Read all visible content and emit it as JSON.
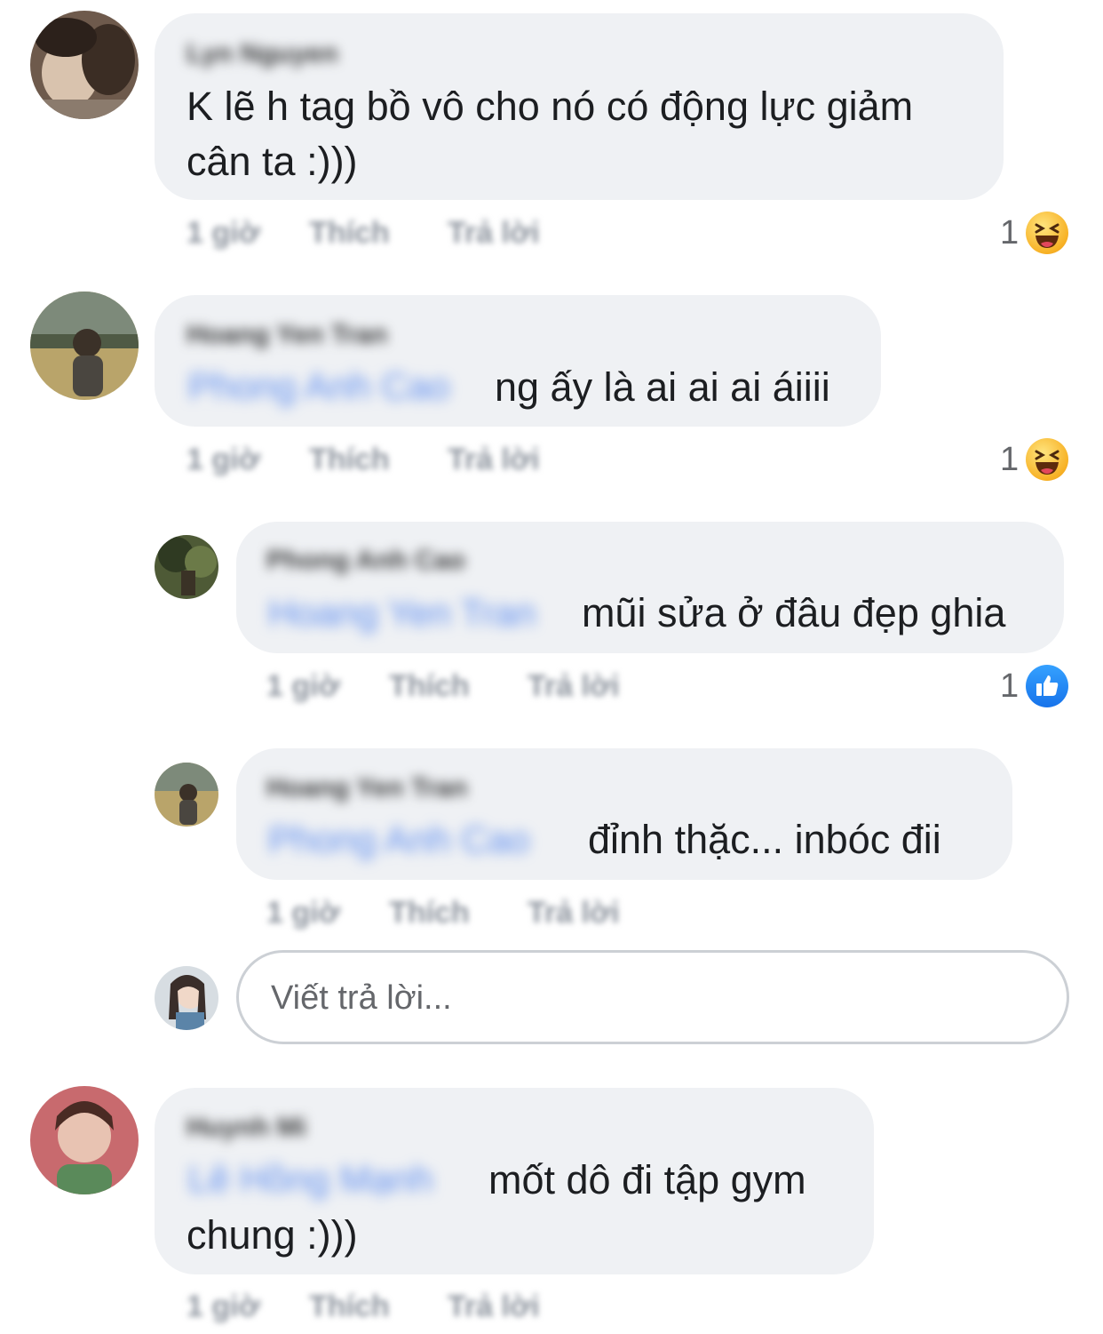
{
  "comments": [
    {
      "author": "Lyn Nguyen",
      "text_lines": [
        "K lẽ h tag bồ vô cho nó có động lực giảm",
        "cân ta :)))"
      ],
      "time": "1 giờ",
      "like_label": "Thích",
      "reply_label": "Trả lời",
      "reaction": {
        "count": "1",
        "type": "haha-icon"
      }
    },
    {
      "author": "Hoang Yen Tran",
      "mention": "Phong Anh Cao",
      "text_lines": [
        "ng ấy là ai ai ai áiiii"
      ],
      "time": "1 giờ",
      "like_label": "Thích",
      "reply_label": "Trả lời",
      "reaction": {
        "count": "1",
        "type": "haha-icon"
      }
    },
    {
      "author": "Phong Anh Cao",
      "mention": "Hoang Yen Tran",
      "text_lines": [
        "mũi sửa ở đâu đẹp ghia"
      ],
      "time": "1 giờ",
      "like_label": "Thích",
      "reply_label": "Trả lời",
      "reaction": {
        "count": "1",
        "type": "like-icon"
      }
    },
    {
      "author": "Hoang Yen Tran",
      "mention": "Phong Anh Cao",
      "text_lines": [
        "đỉnh thặc... inbóc đii"
      ],
      "time": "1 giờ",
      "like_label": "Thích",
      "reply_label": "Trả lời"
    },
    {
      "author": "Huynh Mi",
      "mention": "Lê Hồng Mạnh",
      "text_lines": [
        "mốt dô đi tập gym",
        "chung :)))"
      ],
      "time": "1 giờ",
      "like_label": "Thích",
      "reply_label": "Trả lời"
    }
  ],
  "reply_input": {
    "placeholder": "Viết trả lời..."
  },
  "colors": {
    "bubble": "#eff1f4",
    "mention": "#5f8ef0",
    "meta": "#8d949e",
    "like_blue": "#1773ea",
    "haha_yellow": "#f7b125"
  }
}
